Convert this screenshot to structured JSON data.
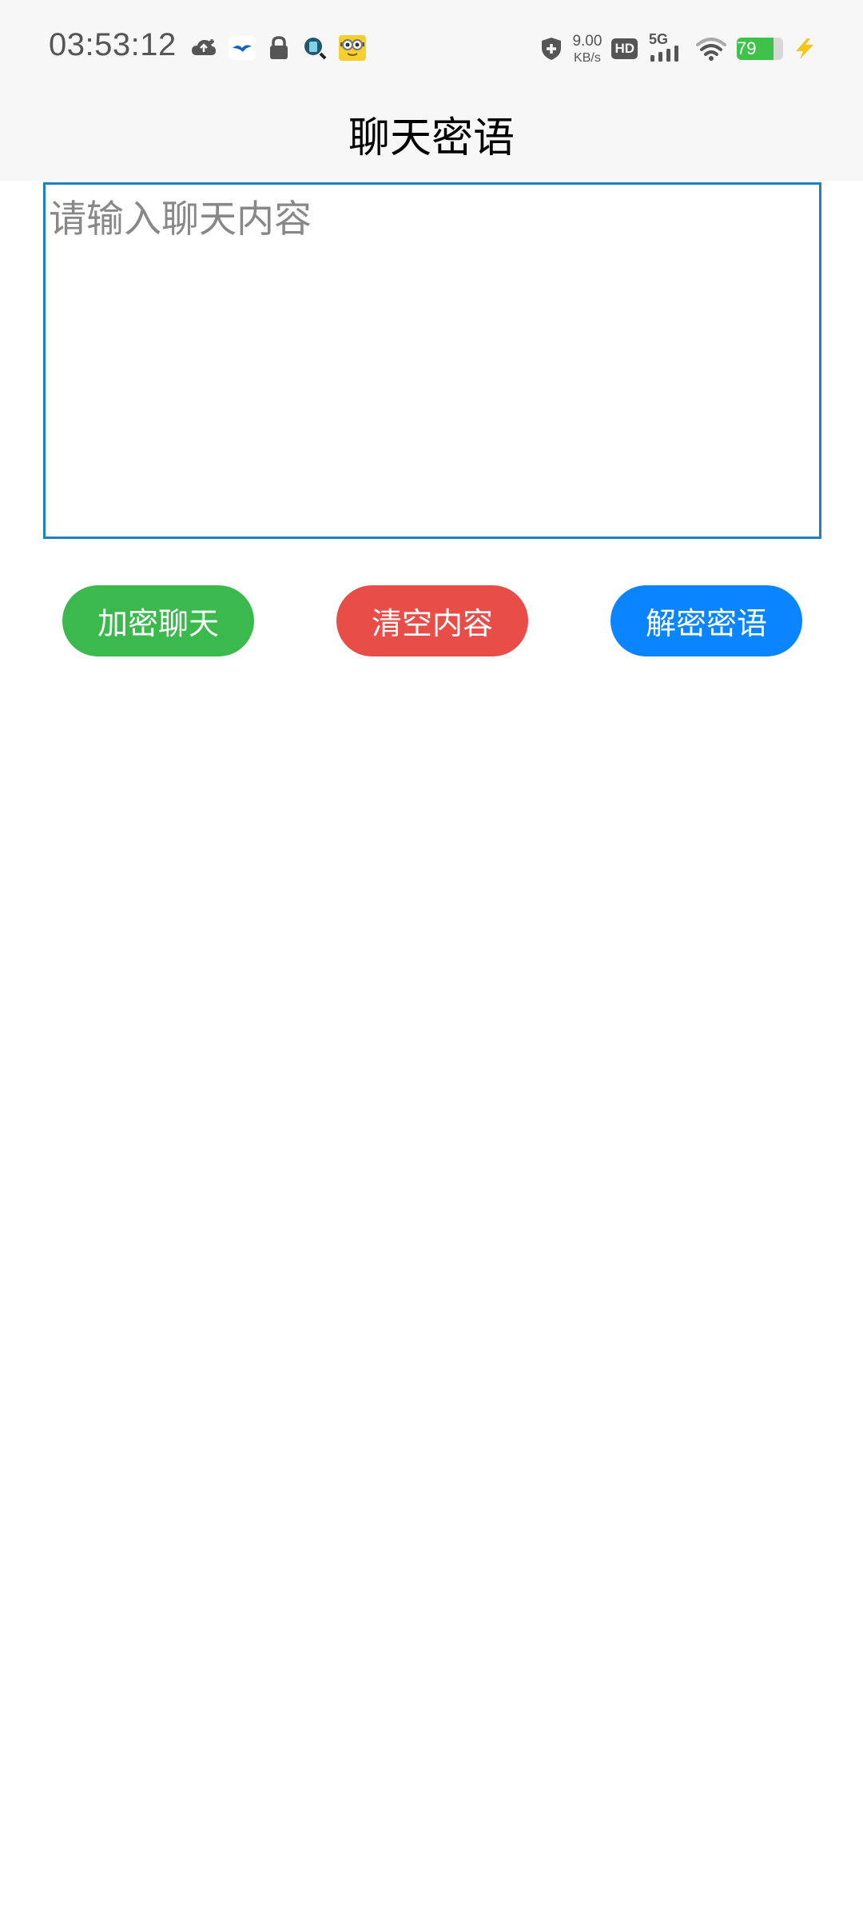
{
  "status_bar": {
    "time": "03:53:12",
    "notification_icons": [
      "cloud-upload-icon",
      "bird-app-icon",
      "lock-icon",
      "search-app-icon",
      "minion-app-icon"
    ],
    "net_speed_value": "9.00",
    "net_speed_unit": "KB/s",
    "hd_label": "HD",
    "network_label": "5G",
    "battery_percent": "79",
    "battery_level": 0.79,
    "charging": true
  },
  "header": {
    "title": "聊天密语",
    "background": "#f7f7f7"
  },
  "chat": {
    "value": "",
    "placeholder": "请输入聊天内容",
    "border_color": "#1f7fc4"
  },
  "buttons": {
    "encrypt": {
      "label": "加密聊天",
      "color": "#3cb94d"
    },
    "clear": {
      "label": "清空内容",
      "color": "#e84e47"
    },
    "decrypt": {
      "label": "解密密语",
      "color": "#0a84ff"
    }
  }
}
